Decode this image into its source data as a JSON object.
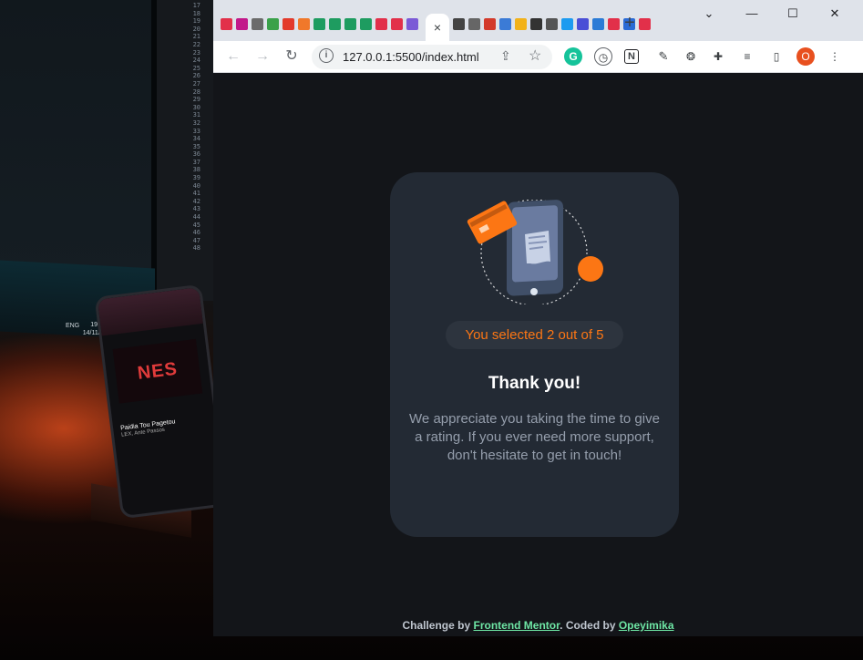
{
  "browser": {
    "active_tab_close": "×",
    "new_tab": "+",
    "url": "127.0.0.1:5500/index.html",
    "profile_initial": "O",
    "window_controls": {
      "minimize": "—",
      "maximize": "☐",
      "close": "✕",
      "tab_list": "⌄"
    }
  },
  "desktop": {
    "line_numbers": [
      "17",
      "18",
      "19",
      "20",
      "21",
      "22",
      "23",
      "24",
      "25",
      "26",
      "27",
      "28",
      "29",
      "30",
      "31",
      "32",
      "33",
      "34",
      "35",
      "36",
      "37",
      "38",
      "39",
      "40",
      "41",
      "42",
      "43",
      "44",
      "45",
      "46",
      "47",
      "48"
    ],
    "tray_lang": "ENG",
    "tray_time": "19:37",
    "tray_date": "14/11/2020",
    "phone_album": "NES",
    "phone_song": "Paidia Tou Pagetou",
    "phone_artist": "LEX, Ante Passos"
  },
  "card": {
    "selected_text": "You selected 2 out of 5",
    "title": "Thank you!",
    "message": "We appreciate you taking the time to give a rating. If you ever need more support, don't hesitate to get in touch!",
    "accent_color": "#fc7614"
  },
  "footer": {
    "prefix": "Challenge by ",
    "link1": "Frontend Mentor",
    "middle": ". Coded by ",
    "link2": "Opeyimika"
  },
  "colors": {
    "page_bg": "#131519",
    "card_bg": "#232a34",
    "badge_text": "#fc7614",
    "link": "#6ee6a5"
  },
  "icons": {
    "toolbar_extensions": [
      "grammarly-icon",
      "compass-icon",
      "notion-icon",
      "eyedropper-icon",
      "openai-icon",
      "puzzle-icon",
      "media-queue-icon",
      "side-panel-icon"
    ]
  }
}
